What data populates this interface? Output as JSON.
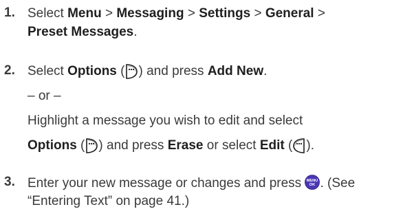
{
  "steps": [
    {
      "number": "1.",
      "lines": [
        {
          "parts": [
            "Select ",
            "Menu",
            " > ",
            "Messaging",
            " > ",
            "Settings",
            " > ",
            "General",
            " >"
          ]
        },
        {
          "parts": [
            "Preset Messages",
            "."
          ]
        }
      ]
    },
    {
      "number": "2.",
      "lines": [
        {
          "parts": [
            "Select ",
            "Options",
            " (",
            ") and press ",
            "Add New",
            "."
          ]
        },
        {
          "text": "– or –"
        },
        {
          "text": "Highlight a message you wish to edit and select"
        },
        {
          "parts": [
            "Options",
            " (",
            ") and press ",
            "Erase",
            " or select ",
            "Edit",
            " (",
            ")."
          ]
        }
      ]
    },
    {
      "number": "3.",
      "lines": [
        {
          "parts": [
            "Enter your new message or changes and press ",
            ". (See"
          ]
        },
        {
          "text": "“Entering Text” on page 41.)"
        }
      ]
    }
  ],
  "icons": {
    "menu_ok_top": "MENU",
    "menu_ok_bottom": "OK",
    "menu_ok_color": "#4b36b5",
    "softkey_color": "#1a1a1a"
  }
}
